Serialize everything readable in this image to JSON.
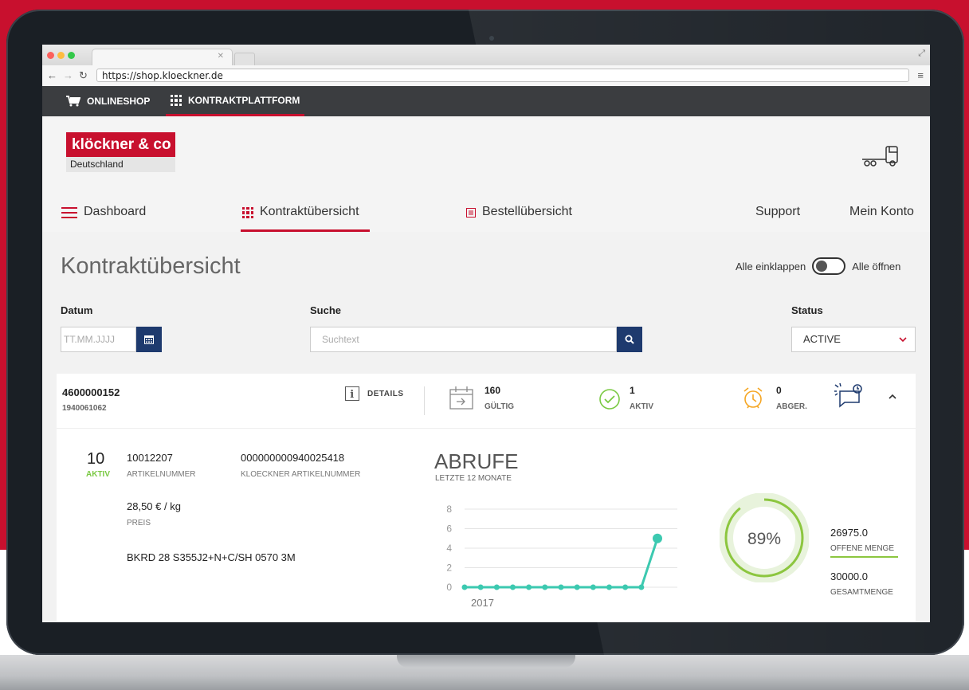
{
  "browser": {
    "url": "https://shop.kloeckner.de"
  },
  "sitebar": {
    "onlineshop": "ONLINESHOP",
    "kontraktplattform": "KONTRAKTPLATTFORM"
  },
  "logo": {
    "brand": "klöckner & co",
    "country": "Deutschland"
  },
  "nav": {
    "dashboard": "Dashboard",
    "kontrakt": "Kontraktübersicht",
    "bestell": "Bestellübersicht",
    "support": "Support",
    "konto": "Mein Konto"
  },
  "page": {
    "title": "Kontraktübersicht",
    "collapse_label": "Alle einklappen",
    "expand_label": "Alle öffnen"
  },
  "filters": {
    "date_label": "Datum",
    "date_placeholder": "TT.MM.JJJJ",
    "search_label": "Suche",
    "search_placeholder": "Suchtext",
    "status_label": "Status",
    "status_value": "ACTIVE"
  },
  "contract": {
    "number": "4600000152",
    "sub_number": "1940061062",
    "details_label": "DETAILS",
    "valid_count": "160",
    "valid_label": "GÜLTIG",
    "active_count": "1",
    "active_label": "AKTIV",
    "expired_count": "0",
    "expired_label": "ABGER."
  },
  "position": {
    "index": "10",
    "state": "AKTIV",
    "article_number": "10012207",
    "article_number_label": "ARTIKELNUMMER",
    "kloeckner_number": "000000000940025418",
    "kloeckner_number_label": "KLOECKNER ARTIKELNUMMER",
    "price": "28,50 € / kg",
    "price_label": "PREIS",
    "description": "BKRD 28 S355J2+N+C/SH 0570 3M"
  },
  "abrufe": {
    "title": "ABRUFE",
    "subtitle": "LETZTE 12 MONATE"
  },
  "chart_data": {
    "type": "line",
    "title": "ABRUFE",
    "subtitle": "LETZTE 12 MONATE",
    "x_label_shown": "2017",
    "x": [
      1,
      2,
      3,
      4,
      5,
      6,
      7,
      8,
      9,
      10,
      11,
      12,
      13
    ],
    "values": [
      0,
      0,
      0,
      0,
      0,
      0,
      0,
      0,
      0,
      0,
      0,
      0,
      5
    ],
    "yticks": [
      "0",
      "2",
      "4",
      "6",
      "8"
    ],
    "ylim": [
      0,
      8
    ],
    "grid": true,
    "color": "#3cc9b0"
  },
  "gauge": {
    "percent_label": "89%",
    "percent": 0.89,
    "open_qty": "26975.0",
    "open_qty_label": "OFFENE MENGE",
    "total_qty": "30000.0",
    "total_qty_label": "GESAMTMENGE",
    "color": "#8cc63f"
  },
  "colors": {
    "brand_red": "#c8102e",
    "navy": "#1e3a6e",
    "green": "#7ac943",
    "orange": "#f5a623"
  }
}
